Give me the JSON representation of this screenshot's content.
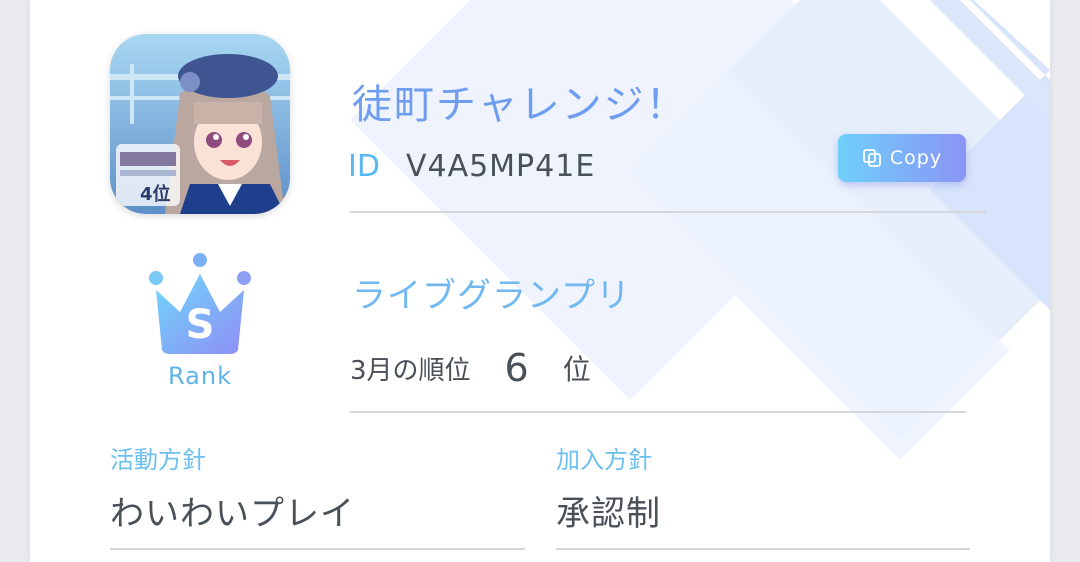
{
  "clan": {
    "name": "徒町チャレンジ！",
    "id_label": "ID",
    "id_value": "V4A5MP41E",
    "copy_label": "Copy",
    "avatar_badge_text": "4位"
  },
  "rank": {
    "badge_letter": "S",
    "badge_label": "Rank"
  },
  "grandprix": {
    "title": "ライブグランプリ",
    "month_label": "3月の順位",
    "position": "6",
    "position_unit": "位"
  },
  "policies": {
    "activity_label": "活動方針",
    "activity_value": "わいわいプレイ",
    "join_label": "加入方針",
    "join_value": "承認制"
  },
  "colors": {
    "accent_blue": "#6f9df0",
    "accent_cyan": "#6cc0ef",
    "gradient_start": "#6fd0fb",
    "gradient_end": "#8a94f4",
    "text_dark": "#4a5058"
  }
}
